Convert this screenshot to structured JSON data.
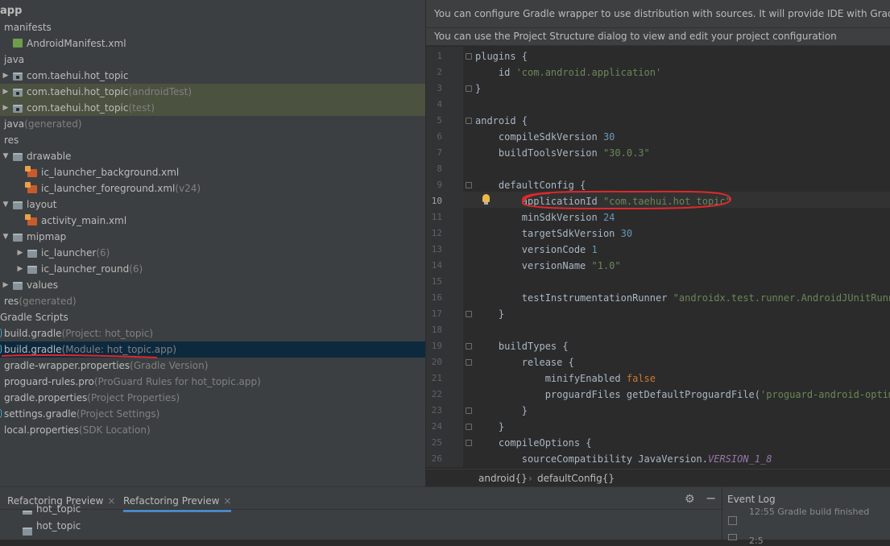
{
  "tree": {
    "rows": [
      {
        "label": "app",
        "hint": ""
      },
      {
        "label": "manifests",
        "hint": ""
      },
      {
        "label": "AndroidManifest.xml",
        "hint": ""
      },
      {
        "label": "java",
        "hint": ""
      },
      {
        "label": "com.taehui.hot_topic",
        "hint": ""
      },
      {
        "label": "com.taehui.hot_topic",
        "hint": "(androidTest)"
      },
      {
        "label": "com.taehui.hot_topic",
        "hint": "(test)"
      },
      {
        "label": "java",
        "hint": "(generated)"
      },
      {
        "label": "res",
        "hint": ""
      },
      {
        "label": "drawable",
        "hint": ""
      },
      {
        "label": "ic_launcher_background.xml",
        "hint": ""
      },
      {
        "label": "ic_launcher_foreground.xml",
        "hint": "(v24)"
      },
      {
        "label": "layout",
        "hint": ""
      },
      {
        "label": "activity_main.xml",
        "hint": ""
      },
      {
        "label": "mipmap",
        "hint": ""
      },
      {
        "label": "ic_launcher",
        "hint": "(6)"
      },
      {
        "label": "ic_launcher_round",
        "hint": "(6)"
      },
      {
        "label": "values",
        "hint": ""
      },
      {
        "label": "res",
        "hint": "(generated)"
      },
      {
        "label": "Gradle Scripts",
        "hint": ""
      },
      {
        "label": "build.gradle",
        "hint": "(Project: hot_topic)"
      },
      {
        "label": "build.gradle",
        "hint": "(Module: hot_topic.app)"
      },
      {
        "label": "gradle-wrapper.properties",
        "hint": "(Gradle Version)"
      },
      {
        "label": "proguard-rules.pro",
        "hint": "(ProGuard Rules for hot_topic.app)"
      },
      {
        "label": "gradle.properties",
        "hint": "(Project Properties)"
      },
      {
        "label": "settings.gradle",
        "hint": "(Project Settings)"
      },
      {
        "label": "local.properties",
        "hint": "(SDK Location)"
      }
    ]
  },
  "editor": {
    "banner1": "You can configure Gradle wrapper to use distribution with sources. It will provide IDE with Gradle API/DS",
    "banner2": "You can use the Project Structure dialog to view and edit your project configuration",
    "current_line": "10",
    "lines": [
      {
        "n": "1",
        "t": [
          [
            "p",
            "plugins {"
          ]
        ]
      },
      {
        "n": "2",
        "t": [
          [
            "p",
            "    id "
          ],
          [
            "s",
            "'com.android.application'"
          ]
        ]
      },
      {
        "n": "3",
        "t": [
          [
            "p",
            "}"
          ]
        ]
      },
      {
        "n": "4",
        "t": []
      },
      {
        "n": "5",
        "t": [
          [
            "p",
            "android {"
          ]
        ]
      },
      {
        "n": "6",
        "t": [
          [
            "p",
            "    compileSdkVersion "
          ],
          [
            "n",
            "30"
          ]
        ]
      },
      {
        "n": "7",
        "t": [
          [
            "p",
            "    buildToolsVersion "
          ],
          [
            "s",
            "\"30.0.3\""
          ]
        ]
      },
      {
        "n": "8",
        "t": []
      },
      {
        "n": "9",
        "t": [
          [
            "p",
            "    defaultConfig {"
          ]
        ]
      },
      {
        "n": "10",
        "t": [
          [
            "p",
            "        applicationId "
          ],
          [
            "s",
            "\"com.taehui.hot_topic\""
          ]
        ]
      },
      {
        "n": "11",
        "t": [
          [
            "p",
            "        minSdkVersion "
          ],
          [
            "n",
            "24"
          ]
        ]
      },
      {
        "n": "12",
        "t": [
          [
            "p",
            "        targetSdkVersion "
          ],
          [
            "n",
            "30"
          ]
        ]
      },
      {
        "n": "13",
        "t": [
          [
            "p",
            "        versionCode "
          ],
          [
            "n",
            "1"
          ]
        ]
      },
      {
        "n": "14",
        "t": [
          [
            "p",
            "        versionName "
          ],
          [
            "s",
            "\"1.0\""
          ]
        ]
      },
      {
        "n": "15",
        "t": []
      },
      {
        "n": "16",
        "t": [
          [
            "p",
            "        testInstrumentationRunner "
          ],
          [
            "s",
            "\"androidx.test.runner.AndroidJUnitRunner\""
          ]
        ]
      },
      {
        "n": "17",
        "t": [
          [
            "p",
            "    }"
          ]
        ]
      },
      {
        "n": "18",
        "t": []
      },
      {
        "n": "19",
        "t": [
          [
            "p",
            "    buildTypes {"
          ]
        ]
      },
      {
        "n": "20",
        "t": [
          [
            "p",
            "        release {"
          ]
        ]
      },
      {
        "n": "21",
        "t": [
          [
            "p",
            "            minifyEnabled "
          ],
          [
            "k",
            "false"
          ]
        ]
      },
      {
        "n": "22",
        "t": [
          [
            "p",
            "            proguardFiles getDefaultProguardFile("
          ],
          [
            "s",
            "'proguard-android-optimize.txt'"
          ]
        ]
      },
      {
        "n": "23",
        "t": [
          [
            "p",
            "        }"
          ]
        ]
      },
      {
        "n": "24",
        "t": [
          [
            "p",
            "    }"
          ]
        ]
      },
      {
        "n": "25",
        "t": [
          [
            "p",
            "    compileOptions {"
          ]
        ]
      },
      {
        "n": "26",
        "t": [
          [
            "p",
            "        sourceCompatibility JavaVersion."
          ],
          [
            "i",
            "VERSION_1_8"
          ]
        ]
      }
    ],
    "breadcrumbs": [
      "android{}",
      "defaultConfig{}"
    ]
  },
  "bottom": {
    "tabs": [
      {
        "label": "Refactoring Preview",
        "close": "×"
      },
      {
        "label": "Refactoring Preview",
        "close": "×"
      }
    ],
    "rows": [
      "hot_topic",
      "hot_topic"
    ],
    "event_log": {
      "title": "Event Log",
      "line1": "12:55 Gradle build finished",
      "line2": "2:5"
    }
  },
  "colors": {
    "accent": "#4a88c7",
    "annotation": "#e0282a",
    "selection": "#0d293e"
  }
}
